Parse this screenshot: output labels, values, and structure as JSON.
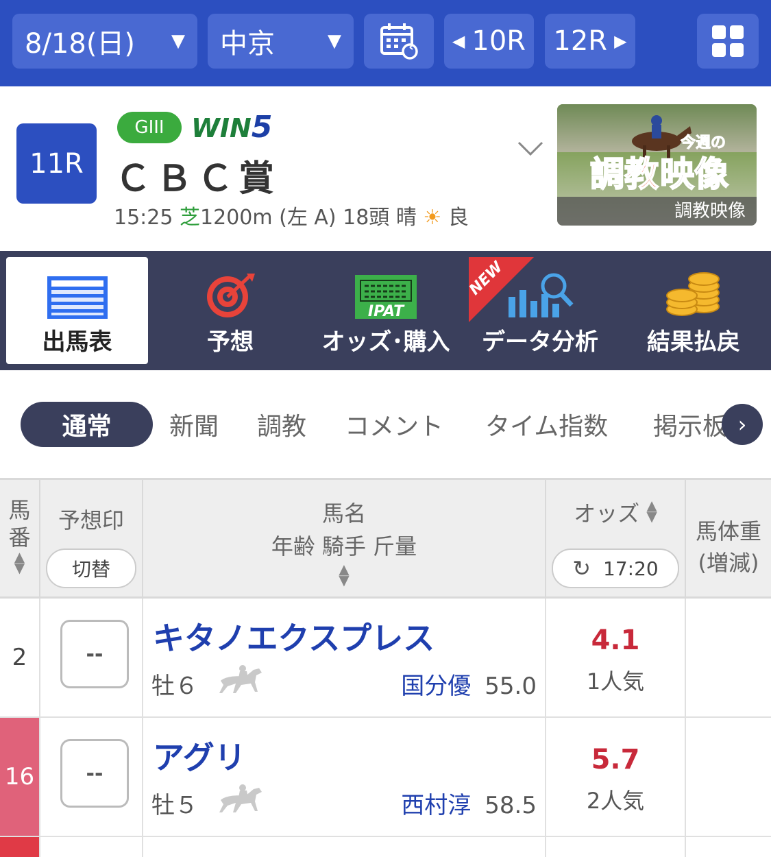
{
  "topbar": {
    "date": "8/18(日)",
    "venue": "中京",
    "prev_race": "10R",
    "next_race": "12R",
    "dropdown_icon": "triangle-down-icon",
    "calendar_icon": "calendar-refresh-icon",
    "grid_icon": "grid-icon"
  },
  "race": {
    "number": "11R",
    "grade": "GIII",
    "win5_prefix": "WIN",
    "win5_suffix": "5",
    "name": "ＣＢＣ賞",
    "time": "15:25",
    "surface": "芝",
    "distance": "1200m (左 A) 18頭 晴",
    "going": "良",
    "thumbnail": {
      "kon": "今週の",
      "title_a": "調教",
      "title_b": "映像",
      "caption": "調教映像"
    }
  },
  "menu": {
    "items": [
      {
        "label": "出馬表",
        "icon": "race-card-icon"
      },
      {
        "label": "予想",
        "icon": "target-icon"
      },
      {
        "label": "オッズ･購入",
        "icon": "ipat-icon"
      },
      {
        "label": "データ分析",
        "icon": "chart-magnifier-icon"
      },
      {
        "label": "結果払戻",
        "icon": "coins-icon"
      }
    ],
    "new_badge": "NEW",
    "ipat_text": "IPAT"
  },
  "subtabs": [
    "通常",
    "新聞",
    "調教",
    "コメント",
    "タイム指数",
    "掲示板"
  ],
  "table": {
    "headers": {
      "umaban": "馬\n番",
      "mark": "予想印",
      "mark_toggle": "切替",
      "horse_line1": "馬名",
      "horse_line2": "年齢 騎手 斤量",
      "odds": "オッズ",
      "odds_time": "17:20",
      "weight_line1": "馬体重",
      "weight_line2": "(増減)"
    },
    "rows": [
      {
        "umaban": "2",
        "mark": "--",
        "name": "キタノエクスプレス",
        "sexage": "牡６",
        "jockey": "国分優",
        "kinryo": "55.0",
        "odds": "4.1",
        "popularity": "1人気",
        "weight": "",
        "frame_color": "#ffffff",
        "umaban_color": "#444444"
      },
      {
        "umaban": "16",
        "mark": "--",
        "name": "アグリ",
        "sexage": "牡５",
        "jockey": "西村淳",
        "kinryo": "58.5",
        "odds": "5.7",
        "popularity": "2人気",
        "weight": "",
        "frame_color": "#e0627a",
        "umaban_color": "#ffffff"
      }
    ],
    "third_row_frame_color": "#e03a46"
  }
}
